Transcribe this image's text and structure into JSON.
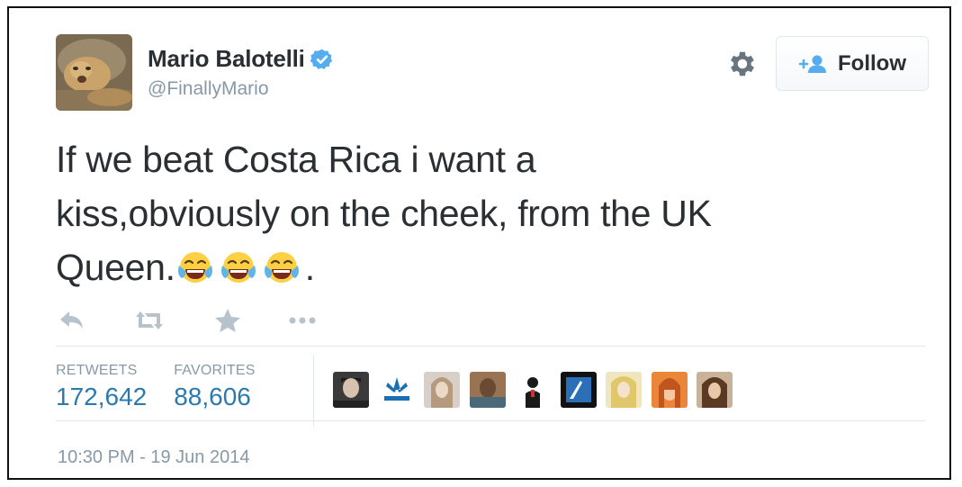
{
  "author": {
    "name": "Mario Balotelli",
    "handle": "@FinallyMario"
  },
  "follow_label": "Follow",
  "tweet": {
    "lines": [
      "If we beat Costa Rica i want a",
      "kiss,obviously on the cheek, from the UK",
      "Queen."
    ],
    "trailing": ".",
    "emoji": "face-with-tears-of-joy"
  },
  "stats": {
    "retweets_label": "RETWEETS",
    "retweets": "172,642",
    "favorites_label": "FAVORITES",
    "favorites": "88,606"
  },
  "timestamp": "10:30 PM - 19 Jun 2014",
  "colors": {
    "verified": "#55acee",
    "stat_value": "#2a7ab0",
    "muted": "#8899a6"
  }
}
